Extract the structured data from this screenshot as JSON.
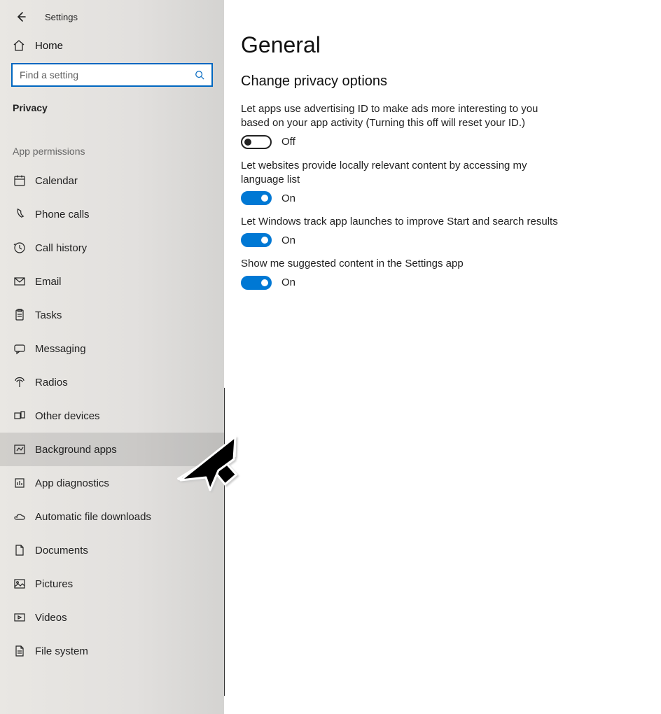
{
  "app": {
    "title": "Settings"
  },
  "sidebar": {
    "home_label": "Home",
    "search_placeholder": "Find a setting",
    "section_title": "Privacy",
    "group_label": "App permissions",
    "items": [
      {
        "label": "Calendar"
      },
      {
        "label": "Phone calls"
      },
      {
        "label": "Call history"
      },
      {
        "label": "Email"
      },
      {
        "label": "Tasks"
      },
      {
        "label": "Messaging"
      },
      {
        "label": "Radios"
      },
      {
        "label": "Other devices"
      },
      {
        "label": "Background apps"
      },
      {
        "label": "App diagnostics"
      },
      {
        "label": "Automatic file downloads"
      },
      {
        "label": "Documents"
      },
      {
        "label": "Pictures"
      },
      {
        "label": "Videos"
      },
      {
        "label": "File system"
      }
    ],
    "selected_index": 8
  },
  "main": {
    "title": "General",
    "subhead": "Change privacy options",
    "options": [
      {
        "desc": "Let apps use advertising ID to make ads more interesting to you based on your app activity (Turning this off will reset your ID.)",
        "on": false,
        "state_label": "Off"
      },
      {
        "desc": "Let websites provide locally relevant content by accessing my language list",
        "on": true,
        "state_label": "On"
      },
      {
        "desc": "Let Windows track app launches to improve Start and search results",
        "on": true,
        "state_label": "On"
      },
      {
        "desc": "Show me suggested content in the Settings app",
        "on": true,
        "state_label": "On"
      }
    ]
  }
}
